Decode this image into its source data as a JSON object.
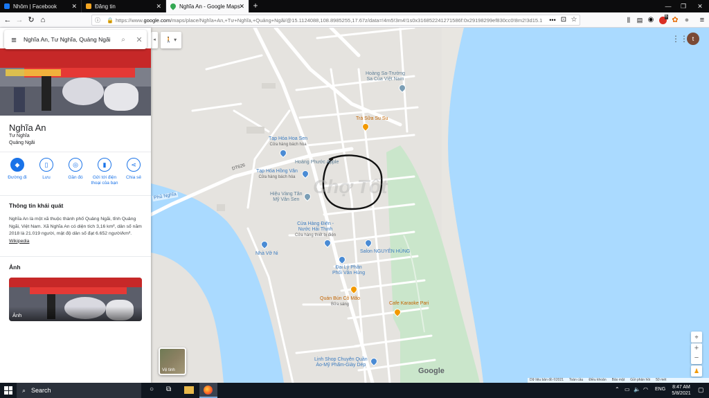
{
  "browser": {
    "tabs": [
      {
        "label": "Nhôm | Facebook",
        "color": "#1877f2"
      },
      {
        "label": "Đăng tin",
        "color": "#f5a623"
      },
      {
        "label": "Nghĩa An - Google Maps",
        "color": "#34a853"
      }
    ],
    "url_prefix": "https://www.",
    "url_host": "google.com",
    "url_rest": "/maps/place/Nghĩa+An,+Tư+Nghĩa,+Quảng+Ngãi/@15.1124088,108.8985255,17.67z/data=!4m5!3m4!1s0x3168522412715​86f:0x29198299ef830cc0!8m2!3d15.1",
    "badge_count": "6"
  },
  "panel": {
    "search_value": "Nghĩa An, Tư Nghĩa, Quảng Ngãi",
    "place_name": "Nghĩa An",
    "place_sub1": "Tư Nghĩa",
    "place_sub2": "Quảng Ngãi",
    "actions": [
      {
        "label": "Đường đi",
        "icon": "directions-icon"
      },
      {
        "label": "Lưu",
        "icon": "bookmark-icon"
      },
      {
        "label": "Gần đó",
        "icon": "nearby-icon"
      },
      {
        "label": "Gửi tới điện thoại của bạn",
        "icon": "send-to-phone-icon"
      },
      {
        "label": "Chia sẻ",
        "icon": "share-icon"
      }
    ],
    "overview_title": "Thông tin khái quát",
    "overview_text": "Nghĩa An là một xã thuộc thành phố Quảng Ngãi, tỉnh Quảng Ngãi, Việt Nam. Xã Nghĩa An có diện tích 3,16 km², dân số năm 2018 là 21.019 người, mật độ dân số đạt 6.652 người/km².",
    "wiki_link": "Wikipedia",
    "photos_title": "Ảnh",
    "photo_caption": "Ảnh"
  },
  "map": {
    "road_label": "DT626",
    "area_label": "Phủ Nghĩa",
    "pois": [
      {
        "name": "Hoàng Sa-Trường",
        "name2": "Sa Của Việt Nam",
        "sub": "",
        "color": "#7b9eb5"
      },
      {
        "name": "Trà Sữa Su Su",
        "name2": "",
        "sub": "",
        "color": "#f29900"
      },
      {
        "name": "Tạp Hóa Hoa Sen",
        "name2": "",
        "sub": "Cửa hàng bách hóa",
        "color": "#4a8bd4"
      },
      {
        "name": "Hoàng Phước Apple",
        "name2": "",
        "sub": "",
        "color": "#7b9eb5"
      },
      {
        "name": "Tạp Hóa Hồng Vân",
        "name2": "",
        "sub": "Cửa hàng bách hóa",
        "color": "#4a8bd4"
      },
      {
        "name": "Hiệu Vàng Tân",
        "name2": "Mỹ Vân Sen",
        "sub": "",
        "color": "#7b9eb5"
      },
      {
        "name": "Cửa Hàng Điện -",
        "name2": "Nước Hải Thịnh",
        "sub": "Cửa hàng thiết bị điện",
        "color": "#4a8bd4"
      },
      {
        "name": "Nhà Vỡ Ni",
        "name2": "",
        "sub": "",
        "color": "#4a8bd4"
      },
      {
        "name": "Salon NGUYÊN HÙNG",
        "name2": "",
        "sub": "",
        "color": "#4a8bd4"
      },
      {
        "name": "Đại Lý Phân",
        "name2": "Phối Văn Hùng",
        "sub": "",
        "color": "#4a8bd4"
      },
      {
        "name": "Quán Bún Cô Mão",
        "name2": "",
        "sub": "Bữa sáng",
        "color": "#f29900"
      },
      {
        "name": "Cafe Karaoke Pari",
        "name2": "",
        "sub": "",
        "color": "#f29900"
      },
      {
        "name": "Linh Shop Chuyên Quần",
        "name2": "Áo-Mỹ Phẩm-Giày Dép",
        "sub": "",
        "color": "#4a8bd4"
      }
    ],
    "satellite_label": "Vệ tinh",
    "watermark": "Chợ Tốt",
    "google_logo": "Google",
    "footer": [
      "Dữ liệu bản đồ ©2021",
      "Toàn cầu",
      "Điều khoản",
      "Bảo mật",
      "Gửi phản hồi",
      "50 mét"
    ],
    "avatar_letter": "t"
  },
  "taskbar": {
    "search_label": "Search",
    "lang": "ENG",
    "time": "8:47 AM",
    "date": "5/8/2021"
  }
}
